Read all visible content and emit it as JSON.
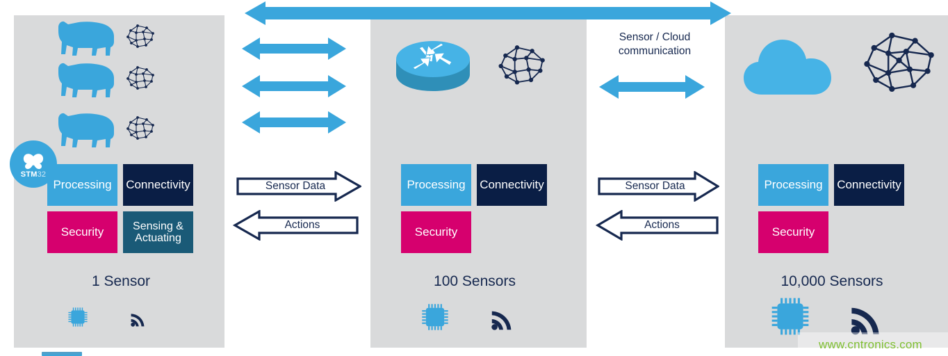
{
  "diagram": {
    "title_fragment": "",
    "background": "#ffffff",
    "panel_bg": "#d9dadb",
    "colors": {
      "light_blue": "#3aa6dc",
      "navy": "#0a1e45",
      "magenta": "#d6006e",
      "teal": "#1a5a77",
      "text_navy": "#16284f",
      "watermark_green": "#76bc21"
    }
  },
  "top_arrow": {
    "name": "end-to-end-double-arrow",
    "direction": "double",
    "color": "#3aa6dc"
  },
  "panels": [
    {
      "id": "edge",
      "count_label": "1 Sensor",
      "animal_icons": [
        "cow",
        "cow",
        "cow"
      ],
      "ai_icons": [
        "neural-brain",
        "neural-brain",
        "neural-brain"
      ],
      "badge": {
        "brand": "STM",
        "number": "32",
        "logo": "butterfly"
      },
      "blocks": [
        {
          "label": "Processing",
          "color": "#3aa6dc"
        },
        {
          "label": "Connectivity",
          "color": "#0a1e45"
        },
        {
          "label": "Security",
          "color": "#d6006e"
        },
        {
          "label": "Sensing & Actuating",
          "color": "#1a5a77"
        }
      ],
      "bottom_icons": [
        "chip",
        "wireless-signal"
      ]
    },
    {
      "id": "gateway",
      "count_label": "100 Sensors",
      "device_icon": "router",
      "ai_icons": [
        "neural-brain"
      ],
      "blocks": [
        {
          "label": "Processing",
          "color": "#3aa6dc"
        },
        {
          "label": "Connectivity",
          "color": "#0a1e45"
        },
        {
          "label": "Security",
          "color": "#d6006e"
        }
      ],
      "bottom_icons": [
        "chip",
        "wireless-signal"
      ]
    },
    {
      "id": "cloud",
      "count_label": "10,000 Sensors",
      "device_icon": "cloud",
      "ai_icons": [
        "neural-brain"
      ],
      "blocks": [
        {
          "label": "Processing",
          "color": "#3aa6dc"
        },
        {
          "label": "Connectivity",
          "color": "#0a1e45"
        },
        {
          "label": "Security",
          "color": "#d6006e"
        }
      ],
      "bottom_icons": [
        "chip",
        "wireless-signal"
      ]
    }
  ],
  "gaps": [
    {
      "id": "gap-left",
      "double_arrows": 3,
      "flows": [
        {
          "label": "Sensor Data",
          "direction": "right"
        },
        {
          "label": "Actions",
          "direction": "left"
        }
      ]
    },
    {
      "id": "gap-right",
      "caption_line1": "Sensor / Cloud",
      "caption_line2": "communication",
      "double_arrows": 1,
      "flows": [
        {
          "label": "Sensor Data",
          "direction": "right"
        },
        {
          "label": "Actions",
          "direction": "left"
        }
      ]
    }
  ],
  "watermark": {
    "text": "www.cntronics.com"
  }
}
